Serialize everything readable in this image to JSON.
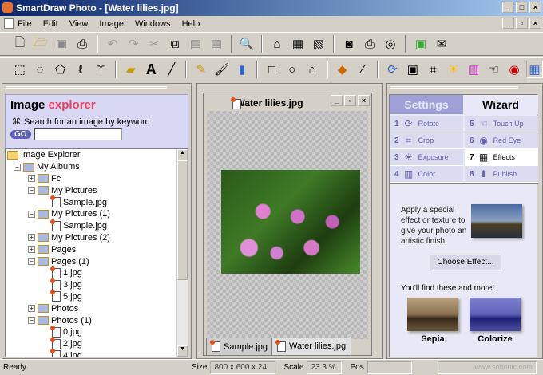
{
  "window": {
    "title": "SmartDraw Photo - [Water lilies.jpg]"
  },
  "menu": [
    "File",
    "Edit",
    "View",
    "Image",
    "Windows",
    "Help"
  ],
  "explorer": {
    "title_a": "Image",
    "title_b": "explorer",
    "search_label": "Search for an image by keyword",
    "go": "GO",
    "search_value": "",
    "tree": [
      {
        "label": "Image Explorer",
        "level": 0,
        "type": "folder",
        "toggle": ""
      },
      {
        "label": "My Albums",
        "level": 1,
        "type": "album",
        "toggle": "-"
      },
      {
        "label": "Fc",
        "level": 2,
        "type": "album",
        "toggle": "+"
      },
      {
        "label": "My Pictures",
        "level": 2,
        "type": "album",
        "toggle": "-"
      },
      {
        "label": "Sample.jpg",
        "level": 3,
        "type": "file",
        "toggle": ""
      },
      {
        "label": "My Pictures (1)",
        "level": 2,
        "type": "album",
        "toggle": "-"
      },
      {
        "label": "Sample.jpg",
        "level": 3,
        "type": "file",
        "toggle": ""
      },
      {
        "label": "My Pictures (2)",
        "level": 2,
        "type": "album",
        "toggle": "+"
      },
      {
        "label": "Pages",
        "level": 2,
        "type": "album",
        "toggle": "+"
      },
      {
        "label": "Pages (1)",
        "level": 2,
        "type": "album",
        "toggle": "-"
      },
      {
        "label": "1.jpg",
        "level": 3,
        "type": "file",
        "toggle": ""
      },
      {
        "label": "3.jpg",
        "level": 3,
        "type": "file",
        "toggle": ""
      },
      {
        "label": "5.jpg",
        "level": 3,
        "type": "file",
        "toggle": ""
      },
      {
        "label": "Photos",
        "level": 2,
        "type": "album",
        "toggle": "+"
      },
      {
        "label": "Photos (1)",
        "level": 2,
        "type": "album",
        "toggle": "-"
      },
      {
        "label": "0.jpg",
        "level": 3,
        "type": "file",
        "toggle": ""
      },
      {
        "label": "2.jpg",
        "level": 3,
        "type": "file",
        "toggle": ""
      },
      {
        "label": "4.jpg",
        "level": 3,
        "type": "file",
        "toggle": ""
      }
    ]
  },
  "document": {
    "title": "Water lilies.jpg",
    "tabs": [
      "Sample.jpg",
      "Water lilies.jpg"
    ],
    "active_tab": 1
  },
  "wizard": {
    "tabs": [
      "Settings",
      "Wizard"
    ],
    "active_tab": 1,
    "steps": [
      {
        "n": "1",
        "label": "Rotate",
        "icon": "⟳"
      },
      {
        "n": "2",
        "label": "Crop",
        "icon": "⌗"
      },
      {
        "n": "3",
        "label": "Exposure",
        "icon": "☀"
      },
      {
        "n": "4",
        "label": "Color",
        "icon": "▥"
      },
      {
        "n": "5",
        "label": "Touch Up",
        "icon": "☜"
      },
      {
        "n": "6",
        "label": "Red Eye",
        "icon": "◉"
      },
      {
        "n": "7",
        "label": "Effects",
        "icon": "▦"
      },
      {
        "n": "8",
        "label": "Publish",
        "icon": "⬆"
      }
    ],
    "active_step": 6,
    "description": "Apply a special effect or texture to give your photo an artistic finish.",
    "choose_button": "Choose Effect...",
    "more_label": "You'll find these and more!",
    "examples": [
      "Sepia",
      "Colorize"
    ]
  },
  "status": {
    "ready": "Ready",
    "size_label": "Size",
    "size_value": "800 x 600 x 24",
    "scale_label": "Scale",
    "scale_value": "23.3 %",
    "pos_label": "Pos",
    "pos_value": ""
  },
  "watermark": "www.softonic.com"
}
